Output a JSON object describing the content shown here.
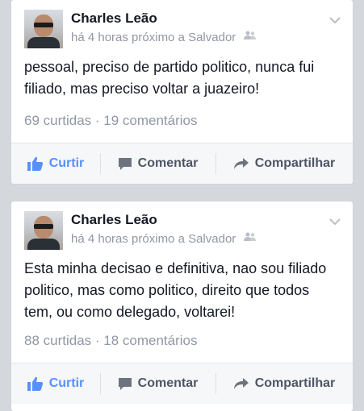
{
  "posts": [
    {
      "author": "Charles Leão",
      "meta": "há 4 horas próximo a Salvador",
      "text": "pessoal, preciso de partido politico, nunca fui filiado, mas preciso voltar a juazeiro!",
      "counts": "69 curtidas · 19 comentários",
      "actions": {
        "like": "Curtir",
        "comment": "Comentar",
        "share": "Compartilhar"
      }
    },
    {
      "author": "Charles Leão",
      "meta": "há 4 horas próximo a Salvador",
      "text": "Esta minha decisao e definitiva, nao sou filiado politico, mas como politico, direito que todos tem, ou como delegado, voltarei!",
      "counts": "88 curtidas · 18 comentários",
      "actions": {
        "like": "Curtir",
        "comment": "Comentar",
        "share": "Compartilhar"
      }
    }
  ],
  "icons": {
    "like": "thumbs-up-icon",
    "comment": "comment-bubble-icon",
    "share": "share-arrow-icon",
    "privacy": "friends-icon",
    "menu": "chevron-down-icon"
  },
  "colors": {
    "background": "#d4d7dc",
    "like_blue": "#5890ff",
    "text": "#141823",
    "meta_gray": "#9197a3"
  }
}
